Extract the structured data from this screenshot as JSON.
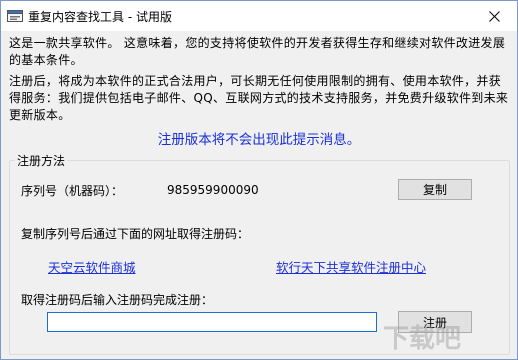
{
  "window": {
    "title": "重复内容查找工具 - 试用版",
    "close_icon": "close-icon"
  },
  "intro": {
    "paragraph1": "这是一款共享软件。 这意味着，您的支持将使软件的开发者获得生存和继续对软件改进发展的基本条件。",
    "paragraph2": "注册后，将成为本软件的正式合法用户，可长期无任何使用限制的拥有、使用本软件，并获得服务：我们提供包括电子邮件、QQ、互联网方式的技术支持服务，并免费升级软件到未来更新版本。",
    "notice": "注册版本将不会出现此提示消息。"
  },
  "registration": {
    "group_title": "注册方法",
    "serial_label": "序列号（机器码）：",
    "serial_value": "985959900090",
    "copy_button": "复制",
    "instruction_links": "复制序列号后通过下面的网址取得注册码：",
    "link1": "天空云软件商城",
    "link2": "软行天下共享软件注册中心",
    "instruction_input": "取得注册码后输入注册码完成注册：",
    "code_value": "",
    "register_button": "注册"
  },
  "colors": {
    "accent": "#1a2fd8",
    "window_bg": "#f0f0f0",
    "input_focus_border": "#1a6fd6"
  }
}
